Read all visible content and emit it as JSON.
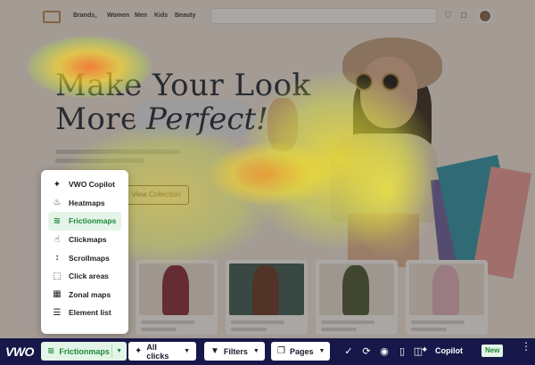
{
  "site": {
    "nav_links": [
      "Brands",
      "Women",
      "Men",
      "Kids",
      "Beauty"
    ],
    "headline_line1": "Make Your Look",
    "headline_line2_prefix": "More",
    "headline_line2_highlight": "Perfect!",
    "cta_label": "View Collection"
  },
  "menu": {
    "items": [
      {
        "label": "VWO Copilot",
        "icon": "sparkle-icon",
        "glyph": "✦"
      },
      {
        "label": "Heatmaps",
        "icon": "flame-icon",
        "glyph": "♨"
      },
      {
        "label": "Frictionmaps",
        "icon": "frictionmap-icon",
        "glyph": "≋",
        "selected": true
      },
      {
        "label": "Clickmaps",
        "icon": "pointer-click-icon",
        "glyph": "☝"
      },
      {
        "label": "Scrollmaps",
        "icon": "scroll-arrows-icon",
        "glyph": "↕"
      },
      {
        "label": "Click areas",
        "icon": "dashed-square-icon",
        "glyph": "⬚"
      },
      {
        "label": "Zonal maps",
        "icon": "grid-icon",
        "glyph": "▦"
      },
      {
        "label": "Element list",
        "icon": "list-icon",
        "glyph": "☰"
      }
    ]
  },
  "toolbar": {
    "brand": "VWO",
    "map_type_label": "Frictionmaps",
    "clicks_label": "All clicks",
    "filters_label": "Filters",
    "pages_label": "Pages",
    "copilot_label": "Copilot",
    "new_badge": "New"
  },
  "colors": {
    "toolbar_bg": "#17174a",
    "accent_green": "#1d8a3a",
    "selected_bg": "#e4f4e8"
  }
}
